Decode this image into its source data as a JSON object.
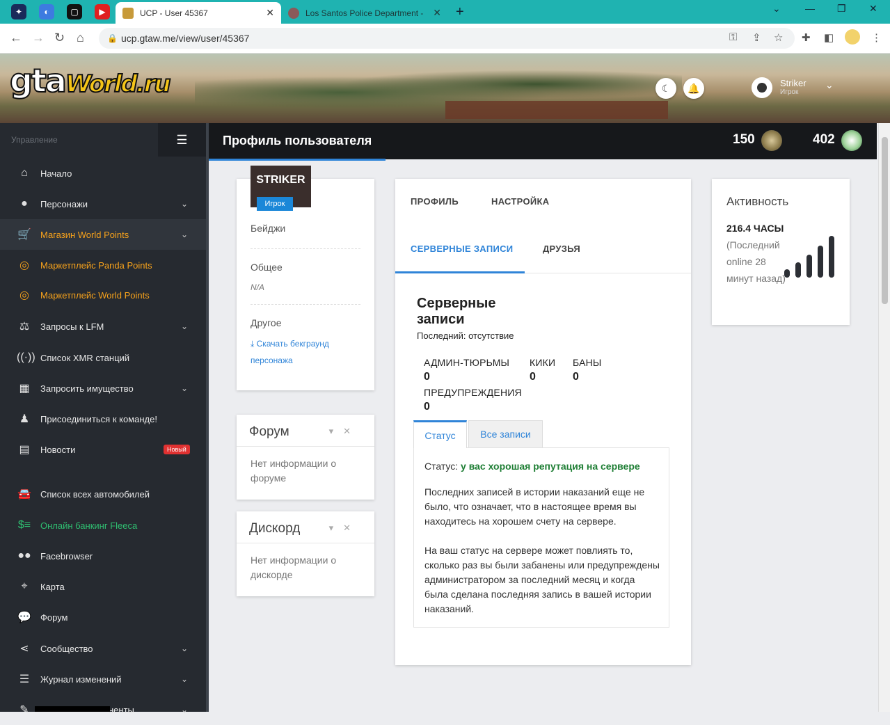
{
  "browser": {
    "tabs": [
      {
        "title": "UCP - User 45367",
        "active": true
      },
      {
        "title": "Los Santos Police Department -",
        "active": false
      }
    ],
    "url": "ucp.gtaw.me/view/user/45367"
  },
  "header": {
    "logo_main": "gta",
    "logo_sub": "World.ru",
    "user_name": "Striker",
    "user_role": "Игрок"
  },
  "sidebar": {
    "heading": "Управление",
    "items": [
      {
        "label": "Начало",
        "icon": "home-icon"
      },
      {
        "label": "Персонажи",
        "icon": "user-icon",
        "chevron": true
      },
      {
        "label": "Магазин World Points",
        "icon": "cart-icon",
        "chevron": true
      },
      {
        "label": "Маркетплейс Panda Points",
        "icon": "coins-icon"
      },
      {
        "label": "Маркетплейс World Points",
        "icon": "coins-icon"
      },
      {
        "label": "Запросы к LFM",
        "icon": "scale-icon",
        "chevron": true
      },
      {
        "label": "Список XMR станций",
        "icon": "antenna-icon"
      },
      {
        "label": "Запросить имущество",
        "icon": "building-icon",
        "chevron": true
      },
      {
        "label": "Присоединиться к команде!",
        "icon": "user-tie-icon"
      },
      {
        "label": "Новости",
        "icon": "newspaper-icon",
        "badge": "Новый"
      },
      {
        "label": "Список всех автомобилей",
        "icon": "car-icon"
      },
      {
        "label": "Онлайн банкинг Fleeca",
        "icon": "money-icon"
      },
      {
        "label": "Facebrowser",
        "icon": "users-icon"
      },
      {
        "label": "Карта",
        "icon": "map-icon"
      },
      {
        "label": "Форум",
        "icon": "comments-icon"
      },
      {
        "label": "Сообщество",
        "icon": "share-icon",
        "chevron": true
      },
      {
        "label": "Журнал изменений",
        "icon": "list-icon",
        "chevron": true
      },
      {
        "label": "ненты",
        "icon": "document-icon",
        "chevron": true
      }
    ]
  },
  "page": {
    "title": "Профиль пользователя",
    "stat1": "150",
    "stat2": "402"
  },
  "profile": {
    "name": "STRIKER",
    "role": "Игрок",
    "badges_label": "Бейджи",
    "general_label": "Общее",
    "general_value": "N/A",
    "other_label": "Другое",
    "download_link": "Скачать бекграунд персонажа"
  },
  "forum_box": {
    "title": "Форум",
    "body": "Нет информации о форуме"
  },
  "discord_box": {
    "title": "Дискорд",
    "body": "Нет информации о дискорде"
  },
  "main_tabs": [
    "ПРОФИЛЬ",
    "НАСТРОЙКА",
    "СЕРВЕРНЫЕ ЗАПИСИ",
    "ДРУЗЬЯ"
  ],
  "records": {
    "title": "Серверные записи",
    "last": "Последний: отсутствие",
    "admin_jail_label": "АДМИН-ТЮРЬМЫ",
    "admin_jail_value": "0",
    "kicks_label": "КИКИ",
    "kicks_value": "0",
    "bans_label": "БАНЫ",
    "bans_value": "0",
    "warnings_label": "ПРЕДУПРЕЖДЕНИЯ",
    "warnings_value": "0",
    "subtab_status": "Статус",
    "subtab_all": "Все записи",
    "status_prefix": "Статус:",
    "status_value": "у вас хорошая репутация на сервере",
    "para1": "Последних записей в истории наказаний еще не было, что означает, что в настоящее время вы находитесь на хорошем счету на сервере.",
    "para2": "На ваш статус на сервере может повлиять то, сколько раз вы были забанены или предупреждены администратором за последний месяц и когда была сделана последняя запись в вашей истории наказаний."
  },
  "activity": {
    "title": "Активность",
    "hours": "216.4 ЧАСЫ",
    "sub": "(Последний online 28 минут назад)"
  }
}
